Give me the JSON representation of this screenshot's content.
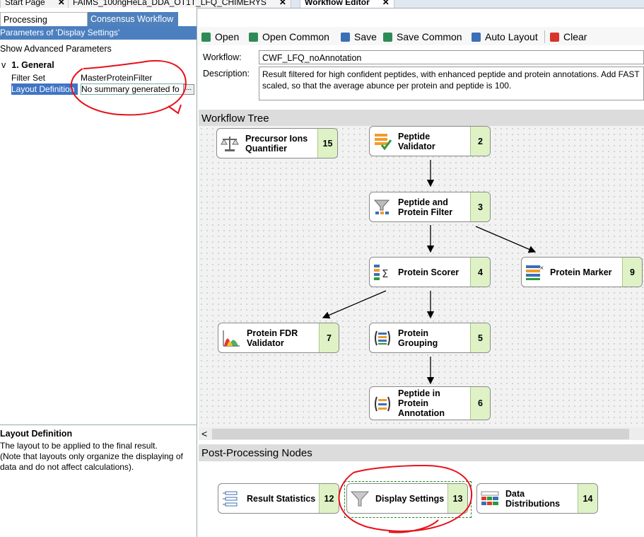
{
  "doc_tabs": [
    {
      "label": "Start Page",
      "close": "✕"
    },
    {
      "label": "FAIMS_100ngHeLa_DDA_OT1T_LFQ_CHIMERYS",
      "close": "✕"
    },
    {
      "label": "Workflow Editor",
      "close": "✕"
    }
  ],
  "left_panel": {
    "tabs": [
      "Processing Workflow",
      "Consensus Workflow"
    ],
    "params_header": "Parameters of 'Display Settings'",
    "show_advanced": "Show Advanced Parameters",
    "group": {
      "chevron": "v",
      "title": "1. General"
    },
    "params": [
      {
        "name": "Filter Set",
        "value": "MasterProteinFilter"
      },
      {
        "name": "Layout Definition",
        "value": "No summary generated fo",
        "button": "..."
      }
    ],
    "description": {
      "title": "Layout Definition",
      "lines": [
        "The layout to be applied to the final result.",
        "(Note that layouts only organize the displaying of",
        "data and do not affect calculations)."
      ]
    }
  },
  "toolbar": [
    {
      "label": "Open",
      "icon": "open-icon",
      "color": "#2e8b57"
    },
    {
      "label": "Open Common",
      "icon": "open-common-icon",
      "color": "#2e8b57"
    },
    {
      "label": "Save",
      "icon": "save-icon",
      "color": "#3b6fb6"
    },
    {
      "label": "Save Common",
      "icon": "save-common-icon",
      "color": "#2e8b57"
    },
    {
      "label": "Auto Layout",
      "icon": "auto-layout-icon",
      "color": "#3b6fb6"
    },
    {
      "label": "Clear",
      "icon": "clear-icon",
      "color": "#d9342b"
    }
  ],
  "workflow": {
    "label": "Workflow:",
    "value": "CWF_LFQ_noAnnotation",
    "desc_label": "Description:",
    "desc_lines": [
      "Result filtered for high confident peptides, with enhanced peptide and protein annotations. Add FAST",
      "scaled, so that the average abunce per protein and peptide is 100."
    ]
  },
  "tree": {
    "title": "Workflow Tree",
    "scroll_left": "<",
    "nodes": [
      {
        "id": "precursor",
        "label": [
          "Precursor Ions",
          "Quantifier"
        ],
        "num": "15",
        "icon": "scale-icon"
      },
      {
        "id": "peptide-validator",
        "label": [
          "Peptide",
          "Validator"
        ],
        "num": "2",
        "icon": "validator-icon"
      },
      {
        "id": "pp-filter",
        "label": [
          "Peptide and",
          "Protein Filter"
        ],
        "num": "3",
        "icon": "filter-icon"
      },
      {
        "id": "protein-scorer",
        "label": [
          "Protein Scorer"
        ],
        "num": "4",
        "icon": "sigma-icon"
      },
      {
        "id": "protein-marker",
        "label": [
          "Protein Marker"
        ],
        "num": "9",
        "icon": "marker-icon"
      },
      {
        "id": "protein-fdr",
        "label": [
          "Protein FDR",
          "Validator"
        ],
        "num": "7",
        "icon": "fdr-icon"
      },
      {
        "id": "protein-grouping",
        "label": [
          "Protein",
          "Grouping"
        ],
        "num": "5",
        "icon": "grouping-icon"
      },
      {
        "id": "pep-in-protein",
        "label": [
          "Peptide in",
          "Protein",
          "Annotation"
        ],
        "num": "6",
        "icon": "annotation-icon"
      }
    ]
  },
  "post": {
    "title": "Post-Processing Nodes",
    "nodes": [
      {
        "id": "result-stats",
        "label": [
          "Result Statistics"
        ],
        "num": "12",
        "icon": "statistics-icon"
      },
      {
        "id": "display-settings",
        "label": [
          "Display Settings"
        ],
        "num": "13",
        "icon": "funnel-icon"
      },
      {
        "id": "data-dist",
        "label": [
          "Data",
          "Distributions"
        ],
        "num": "14",
        "icon": "distribution-icon"
      }
    ]
  },
  "annotation_color": "#e8101a"
}
